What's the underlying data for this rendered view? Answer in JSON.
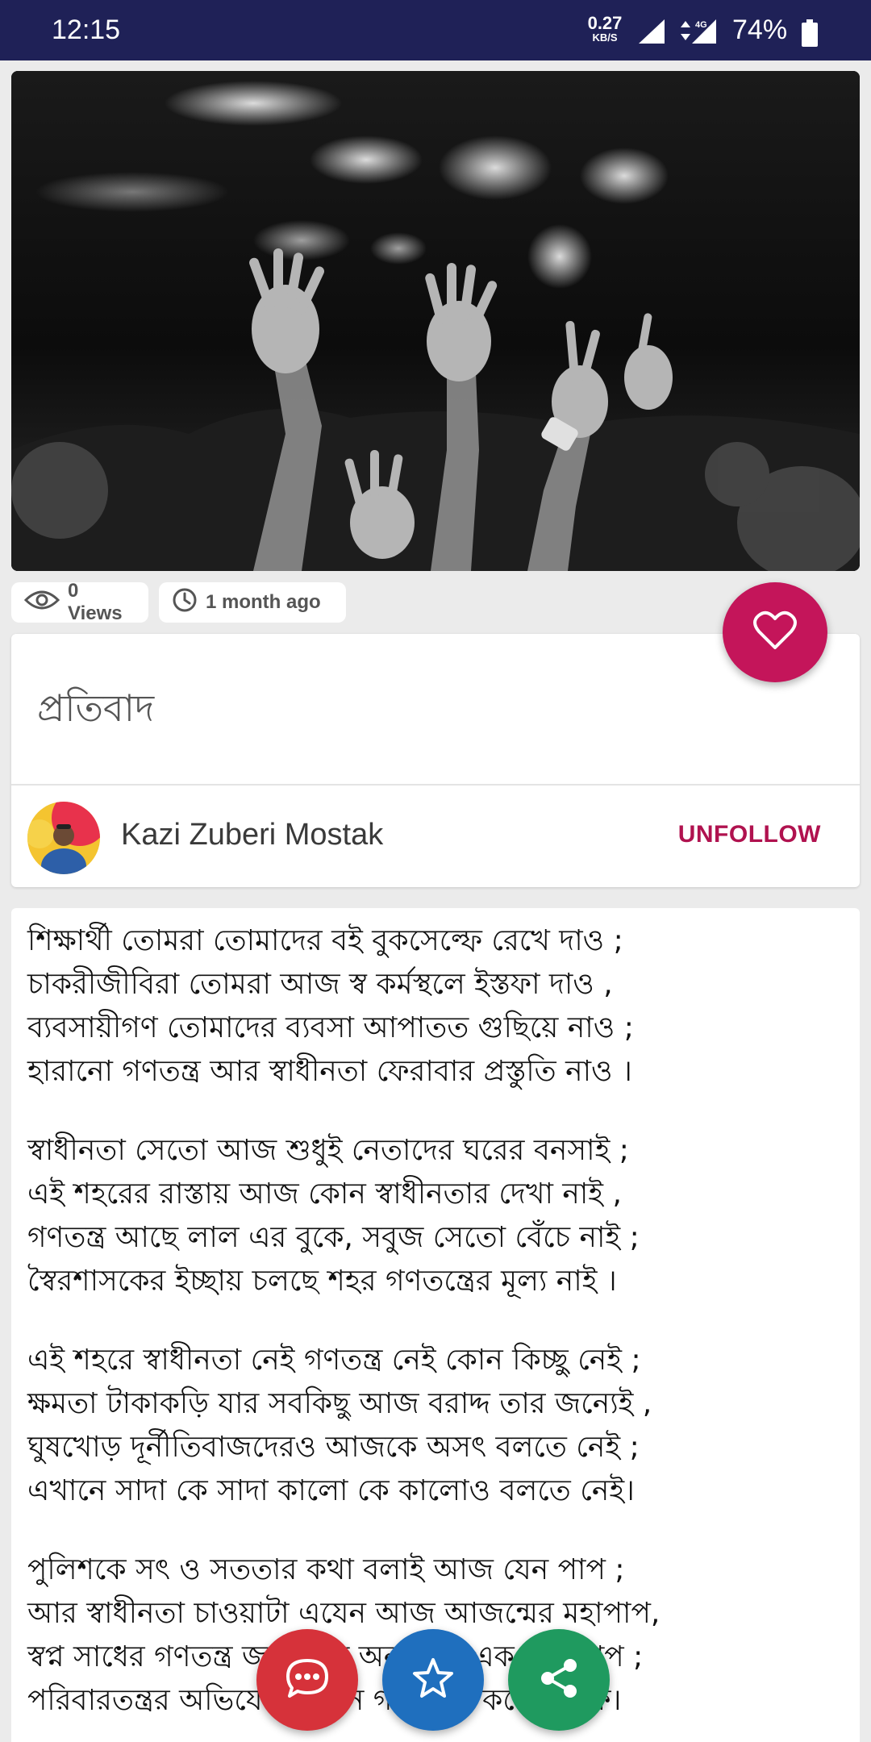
{
  "status_bar": {
    "time": "12:15",
    "net_speed_value": "0.27",
    "net_speed_unit": "KB/S",
    "network": "4G",
    "battery": "74%"
  },
  "post": {
    "views": "0 Views",
    "posted": "1 month ago",
    "title": "প্রতিবাদ",
    "author": "Kazi Zuberi Mostak",
    "follow_label": "UNFOLLOW"
  },
  "poem": {
    "stanzas": [
      {
        "lines": [
          "শিক্ষার্থী তোমরা তোমাদের বই বুকসেল্ফে রেখে দাও ;",
          "চাকরীজীবিরা তোমরা আজ স্ব কর্মস্থলে ইস্তফা দাও ,",
          "ব্যবসায়ীগণ তোমাদের ব্যবসা আপাতত গুছিয়ে নাও ;",
          "হারানো গণতন্ত্র আর স্বাধীনতা ফেরাবার প্রস্তুতি নাও ।"
        ]
      },
      {
        "lines": [
          "স্বাধীনতা সেতো আজ শুধুই নেতাদের ঘরের বনসাই ;",
          "এই শহরের রাস্তায় আজ কোন স্বাধীনতার দেখা নাই ,",
          "গণতন্ত্র আছে লাল এর বুকে, সবুজ সেতো বেঁচে নাই ;",
          "স্বৈরশাসকের ইচ্ছায় চলছে শহর গণতন্ত্রের মূল্য নাই ।"
        ]
      },
      {
        "lines": [
          "এই শহরে স্বাধীনতা নেই গণতন্ত্র নেই কোন কিচ্ছু নেই ;",
          "ক্ষমতা টাকাকড়ি যার সবকিছু আজ বরাদ্দ তার জন্যেই ,",
          "ঘুষখোড় দূর্নীতিবাজদেরও আজকে অসৎ বলতে নেই ;",
          "এখানে সাদা কে সাদা কালো কে কালোও বলতে নেই।"
        ]
      },
      {
        "lines": [
          "পুলিশকে সৎ ও সততার কথা বলাই আজ যেন পাপ ;",
          "আর স্বাধীনতা চাওয়াটা এযেন আজ আজন্মের মহাপাপ,",
          "স্বপ্ন সাধের গণতন্ত্র জনগণের অন্যায়ের এক অভিশাপ ;",
          "পরিবারতন্ত্রর অভিযোগে যখন গণতন্ত্রও করেনি মাফ।"
        ]
      }
    ]
  },
  "actions": {
    "comment_icon": "comment-dots-icon",
    "favorite_icon": "star-icon",
    "share_icon": "share-icon",
    "like_icon": "heart-icon"
  },
  "colors": {
    "status_bar": "#1f2157",
    "accent": "#c4155a",
    "comment": "#d6323a",
    "favorite": "#1f6fbe",
    "share": "#1f9a5f"
  }
}
